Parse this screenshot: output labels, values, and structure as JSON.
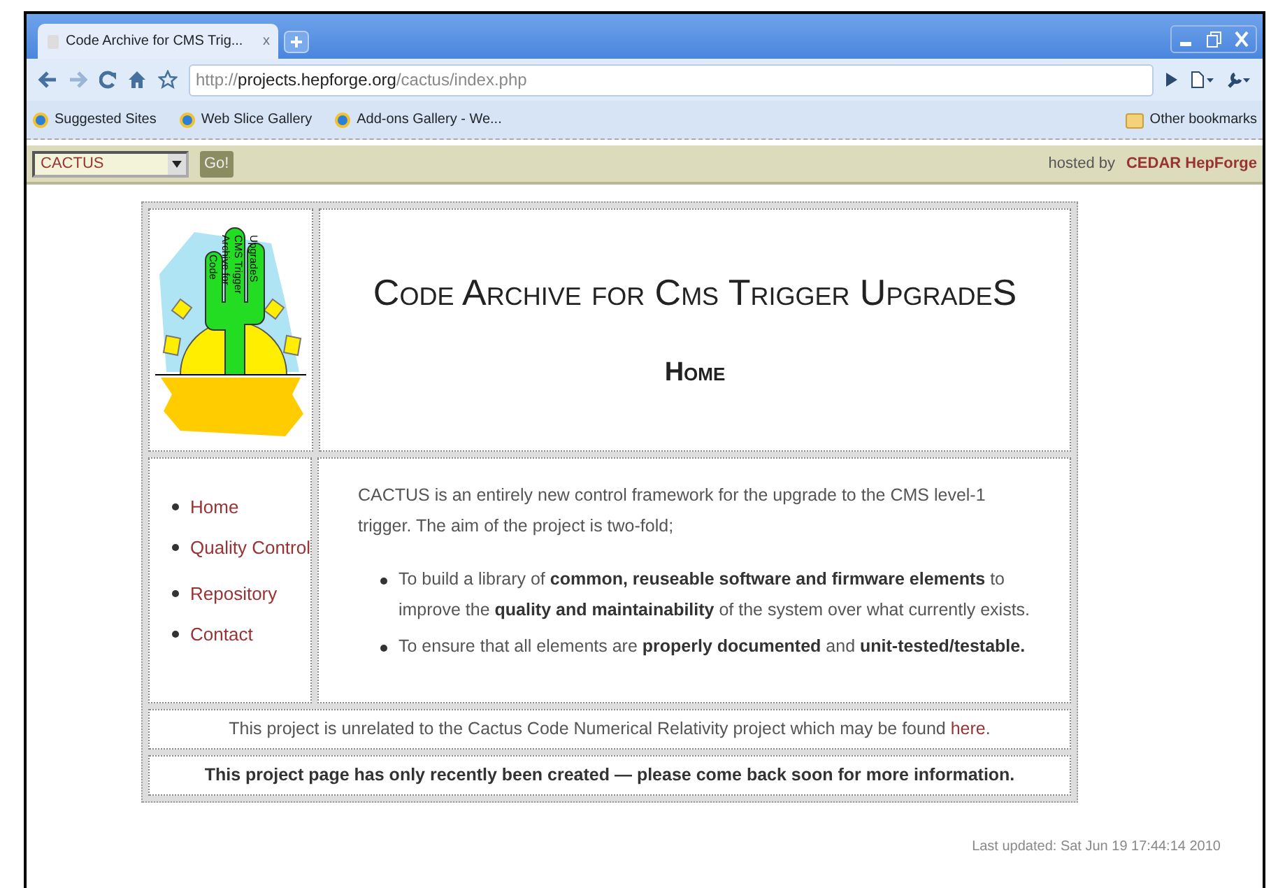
{
  "browser": {
    "tab_title": "Code Archive for CMS Trig...",
    "tab_close": "x",
    "url_scheme": "http://",
    "url_host": "projects.hepforge.org",
    "url_path": "/cactus/index.php",
    "bookmarks": [
      "Suggested Sites",
      "Web Slice Gallery",
      "Add-ons Gallery - We..."
    ],
    "other_bookmarks": "Other bookmarks"
  },
  "hepforge_bar": {
    "project_select": "CACTUS",
    "go_button": "Go!",
    "hosted_by": "hosted by",
    "host_link": "CEDAR HepForge"
  },
  "logo_text": [
    "Code",
    "Archive for",
    "CMS Trigger",
    "UpgradeS"
  ],
  "title": "Code Archive for Cms Trigger UpgradeS",
  "subtitle": "Home",
  "nav_groups": [
    [
      "Home",
      "Quality Control"
    ],
    [
      "Repository",
      "Contact"
    ]
  ],
  "intro": "CACTUS is an entirely new control framework for the upgrade to the CMS level-1 trigger. The aim of the project is two-fold;",
  "goals": [
    "To build a library of **common, reuseable software and firmware elements** to improve the **quality and maintainability** of the system over what currently exists.",
    "To ensure that all elements are **properly documented** and **unit-tested/testable.**"
  ],
  "notice": {
    "text": "This project is unrelated to the Cactus Code Numerical Relativity project which may be found ",
    "link": "here",
    "end": "."
  },
  "announcement": "This project page has only recently been created — please come back soon for more information.",
  "last_updated": "Last updated: Sat Jun 19 17:44:14 2010"
}
